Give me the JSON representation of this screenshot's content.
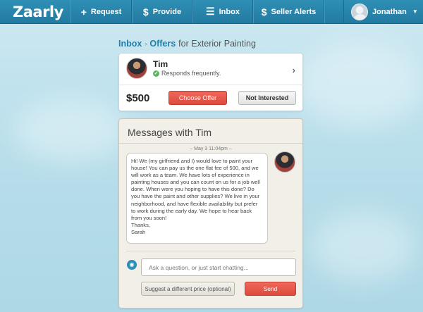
{
  "navbar": {
    "logo_text": "Zaarly",
    "logo_mark": "",
    "items": [
      {
        "icon": "plus-icon",
        "glyph": "+",
        "label": "Request"
      },
      {
        "icon": "dollar-icon",
        "glyph": "$",
        "label": "Provide"
      },
      {
        "icon": "list-icon",
        "glyph": "☰",
        "label": "Inbox"
      },
      {
        "icon": "dollar-icon",
        "glyph": "$",
        "label": "Seller Alerts"
      }
    ],
    "user": {
      "name": "Jonathan",
      "caret": "▼"
    }
  },
  "breadcrumb": {
    "inbox": "Inbox",
    "separator": "›",
    "offers": "Offers",
    "suffix": "for Exterior Painting"
  },
  "offer": {
    "provider_name": "Tim",
    "responds_text": "Responds frequently.",
    "check_glyph": "✓",
    "chevron": "›",
    "price": "$500",
    "choose_label": "Choose Offer",
    "not_interested_label": "Not Interested"
  },
  "messages": {
    "title": "Messages with Tim",
    "date_stamp": "May 3 11:04pm",
    "body": "Hi! We (my girlfriend and I) would love to paint your house! You can pay us the one flat fee of 500, and we will work as a team. We have lots of experience in painting houses and you can count on us for a job well done. When were you hoping to have this done? Do you have the paint and other supplies? We live in your neighborhood, and have flexible availability but prefer to work during the early day. We hope to hear back from you soon!\nThanks,\nSarah",
    "camera_glyph": "◉",
    "input_placeholder": "Ask a question, or just start chatting...",
    "input_value": "",
    "suggest_label": "Suggest a different price (optional)",
    "send_label": "Send"
  },
  "colors": {
    "nav_bg": "#2a86ad",
    "link_blue": "#1f7fae",
    "accent_red": "#e0554a",
    "success_green": "#5cb85c",
    "panel_beige": "#f1efe7"
  }
}
